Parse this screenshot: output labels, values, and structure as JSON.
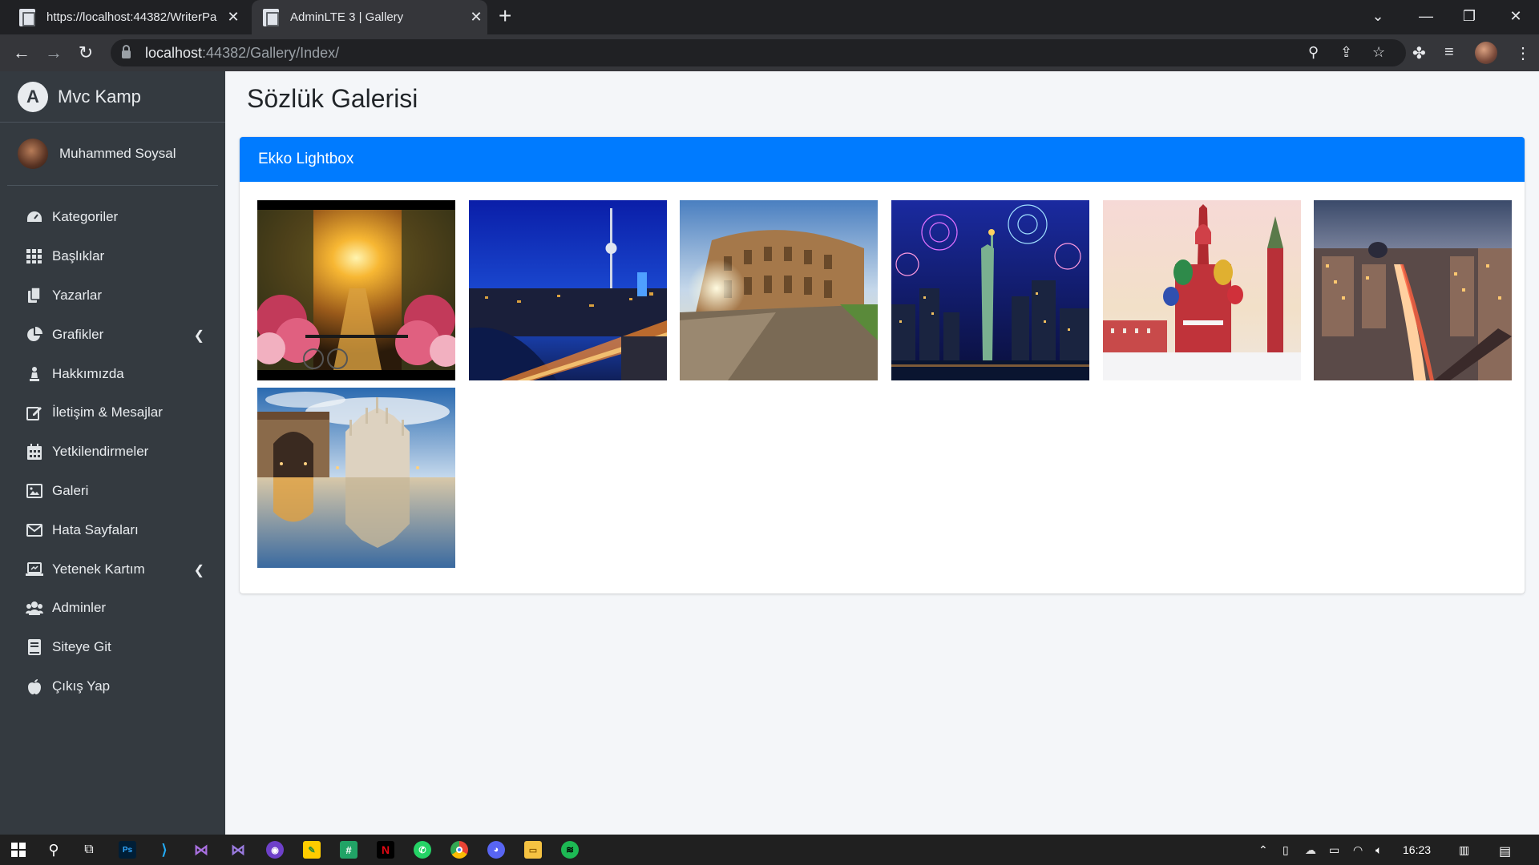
{
  "browser": {
    "tabs": [
      {
        "title": "https://localhost:44382/WriterPa",
        "active": false
      },
      {
        "title": "AdminLTE 3 | Gallery",
        "active": true
      }
    ],
    "url_host": "localhost",
    "url_path": ":44382/Gallery/Index/"
  },
  "sidebar": {
    "brand": "Mvc Kamp",
    "user": "Muhammed Soysal",
    "items": [
      {
        "label": "Kategoriler",
        "icon": "dashboard-icon"
      },
      {
        "label": "Başlıklar",
        "icon": "grid-icon"
      },
      {
        "label": "Yazarlar",
        "icon": "copy-icon"
      },
      {
        "label": "Grafikler",
        "icon": "pie-chart-icon"
      },
      {
        "label": "Hakkımızda",
        "icon": "chess-icon"
      },
      {
        "label": "İletişim & Mesajlar",
        "icon": "edit-icon"
      },
      {
        "label": "Yetkilendirmeler",
        "icon": "calendar-icon"
      },
      {
        "label": "Galeri",
        "icon": "image-icon"
      },
      {
        "label": "Hata Sayfaları",
        "icon": "envelope-icon"
      },
      {
        "label": "Yetenek Kartım",
        "icon": "laptop-icon"
      },
      {
        "label": "Adminler",
        "icon": "users-icon"
      },
      {
        "label": "Siteye Git",
        "icon": "book-icon"
      },
      {
        "label": "Çıkış Yap",
        "icon": "apple-icon"
      }
    ]
  },
  "main": {
    "page_title": "Sözlük Galerisi",
    "card_title": "Ekko Lightbox",
    "images": [
      {
        "scene": "amsterdam-canal-sunset"
      },
      {
        "scene": "berlin-night-tv-tower"
      },
      {
        "scene": "rome-colosseum"
      },
      {
        "scene": "new-york-statue-fireworks"
      },
      {
        "scene": "moscow-st-basils"
      },
      {
        "scene": "madrid-gran-via"
      },
      {
        "scene": "milan-duomo-reflection"
      }
    ]
  },
  "taskbar": {
    "time": "16:23"
  },
  "colors": {
    "accent": "#007bff",
    "sidebar_bg": "#343a40",
    "content_bg": "#f4f6f9"
  }
}
